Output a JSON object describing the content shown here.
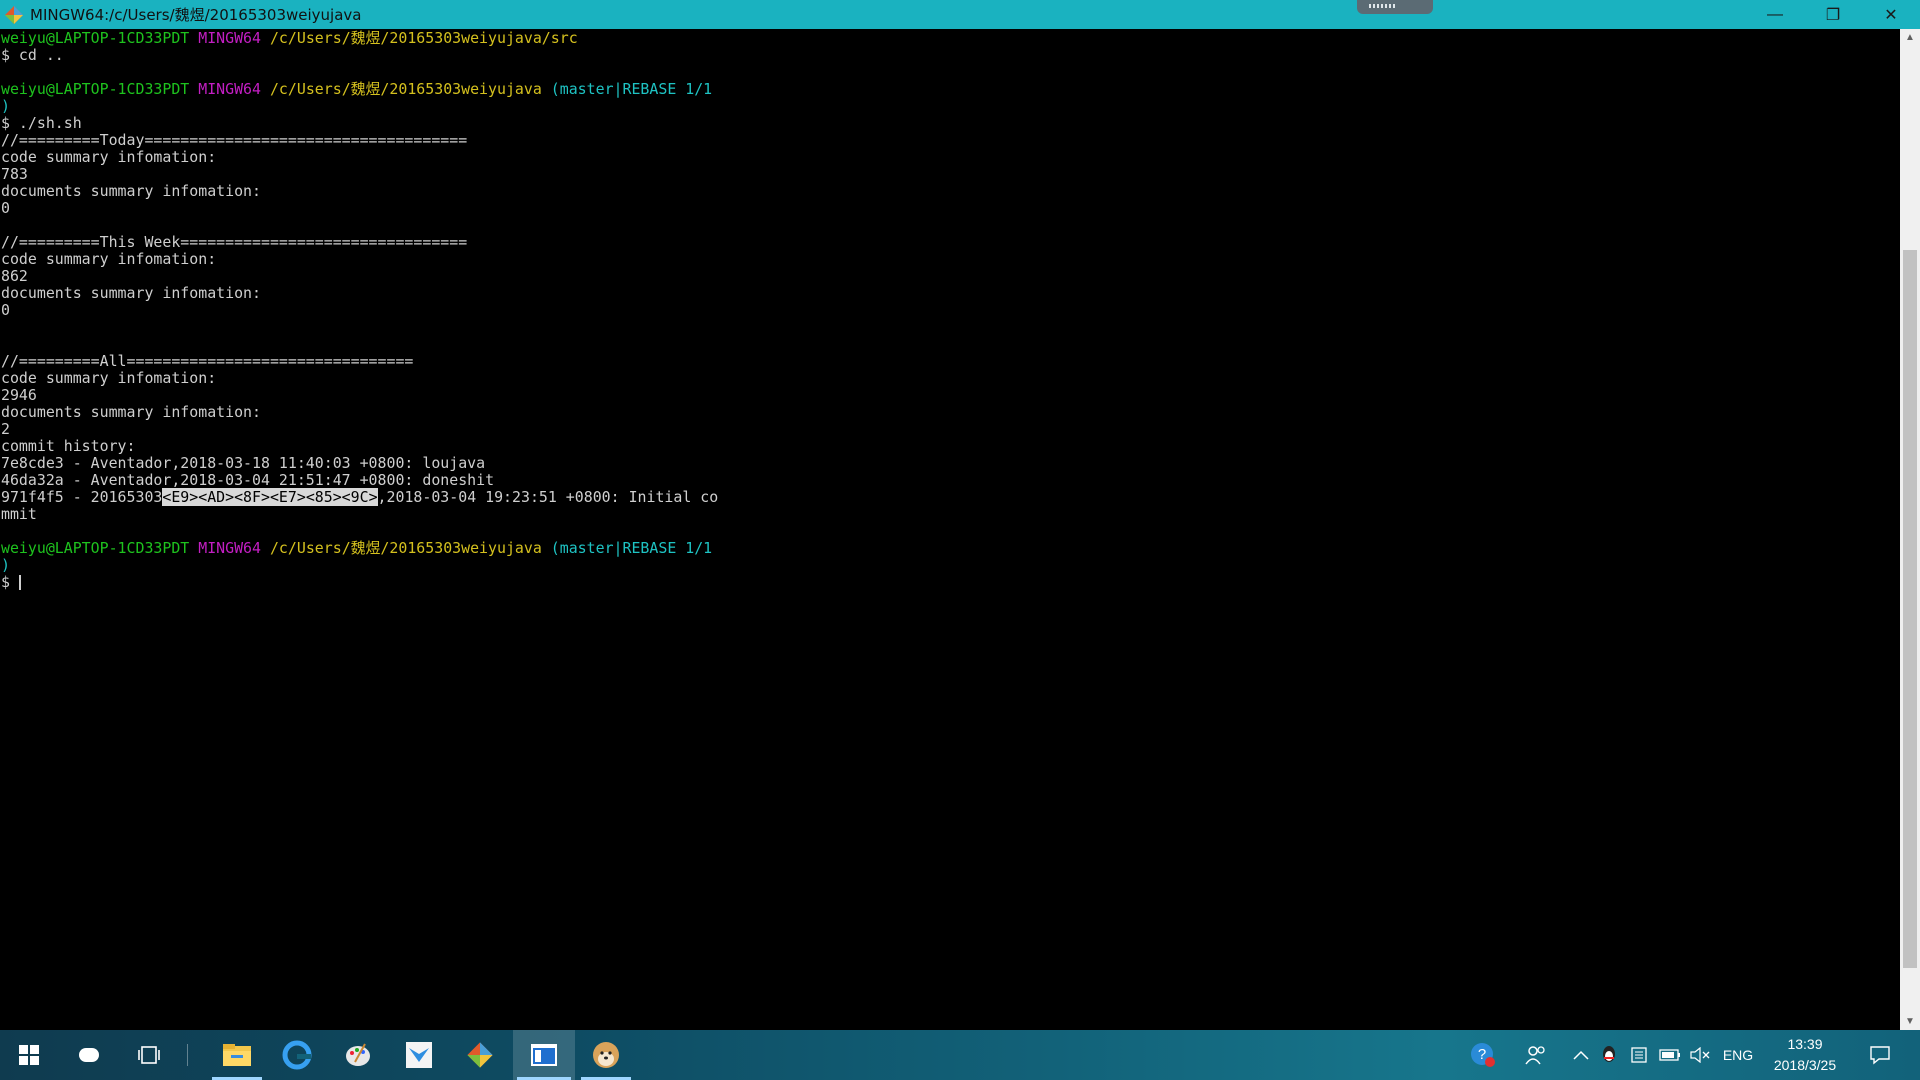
{
  "window": {
    "title": "MINGW64:/c/Users/魏煜/20165303weiyujava",
    "controls": {
      "minimize": "—",
      "restore": "❐",
      "close": "✕"
    }
  },
  "terminal": {
    "lines": [
      [
        {
          "t": "weiyu@LAPTOP-1CD33PDT",
          "c": "g"
        },
        {
          "t": " "
        },
        {
          "t": "MINGW64",
          "c": "m"
        },
        {
          "t": " "
        },
        {
          "t": "/c/Users/魏煜/20165303weiyujava/src",
          "c": "y"
        }
      ],
      [
        {
          "t": "$ cd .."
        }
      ],
      [
        {
          "t": ""
        }
      ],
      [
        {
          "t": "weiyu@LAPTOP-1CD33PDT",
          "c": "g"
        },
        {
          "t": " "
        },
        {
          "t": "MINGW64",
          "c": "m"
        },
        {
          "t": " "
        },
        {
          "t": "/c/Users/魏煜/20165303weiyujava",
          "c": "y"
        },
        {
          "t": " "
        },
        {
          "t": "(master|REBASE 1/1",
          "c": "c"
        }
      ],
      [
        {
          "t": ")",
          "c": "c"
        }
      ],
      [
        {
          "t": "$ ./sh.sh"
        }
      ],
      [
        {
          "t": "//=========Today===================================="
        }
      ],
      [
        {
          "t": "code summary infomation:"
        }
      ],
      [
        {
          "t": "783"
        }
      ],
      [
        {
          "t": "documents summary infomation:"
        }
      ],
      [
        {
          "t": "0"
        }
      ],
      [
        {
          "t": ""
        }
      ],
      [
        {
          "t": "//=========This Week================================"
        }
      ],
      [
        {
          "t": "code summary infomation:"
        }
      ],
      [
        {
          "t": "862"
        }
      ],
      [
        {
          "t": "documents summary infomation:"
        }
      ],
      [
        {
          "t": "0"
        }
      ],
      [
        {
          "t": ""
        }
      ],
      [
        {
          "t": ""
        }
      ],
      [
        {
          "t": "//=========All================================"
        }
      ],
      [
        {
          "t": "code summary infomation:"
        }
      ],
      [
        {
          "t": "2946"
        }
      ],
      [
        {
          "t": "documents summary infomation:"
        }
      ],
      [
        {
          "t": "2"
        }
      ],
      [
        {
          "t": "commit history:"
        }
      ],
      [
        {
          "t": "7e8cde3 - Aventador,2018-03-18 11:40:03 +0800: loujava"
        }
      ],
      [
        {
          "t": "46da32a - Aventador,2018-03-04 21:51:47 +0800: doneshit"
        }
      ],
      [
        {
          "t": "971f4f5 - 20165303"
        },
        {
          "t": "<E9><AD><8F><E7><85><9C>",
          "c": "hl"
        },
        {
          "t": ",2018-03-04 19:23:51 +0800: Initial co"
        }
      ],
      [
        {
          "t": "mmit"
        }
      ],
      [
        {
          "t": ""
        }
      ],
      [
        {
          "t": "weiyu@LAPTOP-1CD33PDT",
          "c": "g"
        },
        {
          "t": " "
        },
        {
          "t": "MINGW64",
          "c": "m"
        },
        {
          "t": " "
        },
        {
          "t": "/c/Users/魏煜/20165303weiyujava",
          "c": "y"
        },
        {
          "t": " "
        },
        {
          "t": "(master|REBASE 1/1",
          "c": "c"
        }
      ],
      [
        {
          "t": ")",
          "c": "c"
        }
      ],
      [
        {
          "t": "$ "
        },
        {
          "cursor": true
        }
      ]
    ]
  },
  "taskbar": {
    "items": [
      {
        "name": "start-button-windows-icon",
        "glyph": "⊞"
      },
      {
        "name": "cortana-icon",
        "glyph": "○"
      },
      {
        "name": "task-view-icon",
        "glyph": "❐"
      },
      {
        "name": "file-explorer-icon",
        "glyph": "📁"
      },
      {
        "name": "browser-icon",
        "glyph": "e"
      },
      {
        "name": "paint-icon",
        "glyph": "🎨"
      },
      {
        "name": "mail-app-icon",
        "glyph": "✉"
      },
      {
        "name": "git-bash-icon",
        "glyph": "◆"
      },
      {
        "name": "terminal-app-icon",
        "glyph": "▣"
      },
      {
        "name": "dog-avatar-app-icon",
        "glyph": "🐕"
      }
    ],
    "tray": {
      "language": "ENG",
      "time": "13:39",
      "date": "2018/3/25"
    }
  },
  "colors": {
    "titlebar": "#1ab2c0",
    "prompt_user": "#1ec31e",
    "prompt_system": "#c31ec3",
    "prompt_path": "#d4c01e",
    "prompt_branch": "#1ec3c3"
  }
}
